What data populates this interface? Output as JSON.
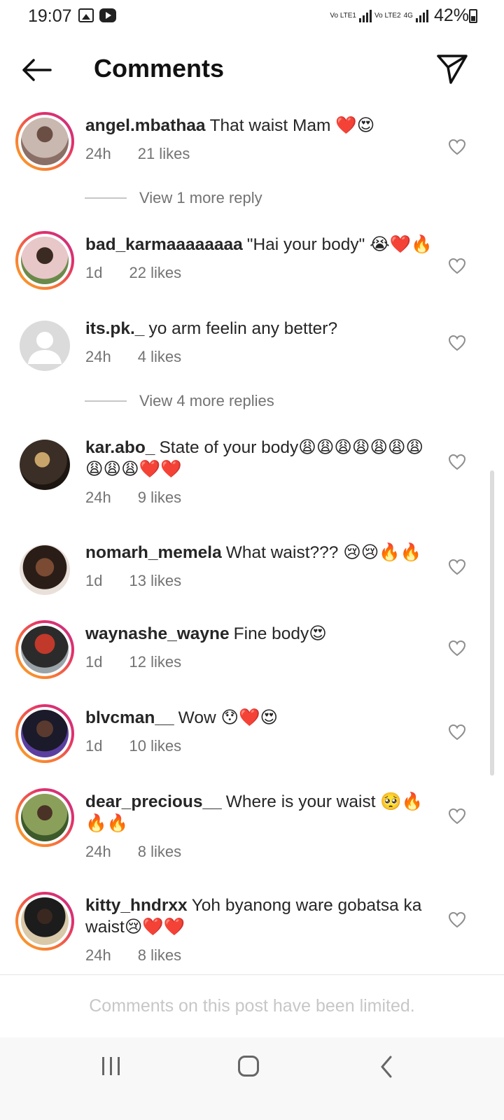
{
  "status_bar": {
    "time": "19:07",
    "net1": "Vo LTE1",
    "net2": "Vo LTE2",
    "net_type": "4G",
    "battery": "42%"
  },
  "header": {
    "title": "Comments",
    "back_icon": "arrow-left-icon",
    "share_icon": "send-icon"
  },
  "comments": [
    {
      "user": "angel.mbathaa",
      "text": "That waist Mam ❤️😍",
      "time": "24h",
      "likes": "21 likes",
      "story_ring": true,
      "avatar": "photo"
    },
    {
      "user": "bad_karmaaaaaaaa",
      "text": "\"Hai your body\" 😭❤️🔥",
      "time": "1d",
      "likes": "22 likes",
      "story_ring": true,
      "avatar": "photo"
    },
    {
      "user": "its.pk._",
      "text": "yo arm feelin any better?",
      "time": "24h",
      "likes": "4 likes",
      "story_ring": false,
      "avatar": "default"
    },
    {
      "user": "kar.abo_",
      "text": "State of your body😩😩😩😩😩😩😩😩😩😩❤️❤️",
      "time": "24h",
      "likes": "9 likes",
      "story_ring": false,
      "avatar": "photo"
    },
    {
      "user": "nomarh_memela",
      "text": "What waist??? 😢😢🔥🔥",
      "time": "1d",
      "likes": "13 likes",
      "story_ring": false,
      "avatar": "photo"
    },
    {
      "user": "waynashe_wayne",
      "text": "Fine body😍",
      "time": "1d",
      "likes": "12 likes",
      "story_ring": true,
      "avatar": "photo"
    },
    {
      "user": "blvcman__",
      "text": "Wow 😯❤️😍",
      "time": "1d",
      "likes": "10 likes",
      "story_ring": true,
      "avatar": "photo"
    },
    {
      "user": "dear_precious__",
      "text": "Where is your waist 🥺🔥🔥🔥",
      "time": "24h",
      "likes": "8 likes",
      "story_ring": true,
      "avatar": "photo"
    },
    {
      "user": "kitty_hndrxx",
      "text": "Yoh byanong ware gobatsa ka waist😢❤️❤️",
      "time": "24h",
      "likes": "8 likes",
      "story_ring": true,
      "avatar": "photo"
    }
  ],
  "view_replies": [
    {
      "label": "View 1 more reply"
    },
    {
      "label": "View 4 more replies"
    }
  ],
  "footer": {
    "limited_text": "Comments on this post have been limited."
  },
  "colors": {
    "story_gradient": [
      "#f9a825",
      "#e1306c",
      "#c13584"
    ],
    "muted_text": "#737373",
    "footer_text": "#c7c7c7"
  }
}
